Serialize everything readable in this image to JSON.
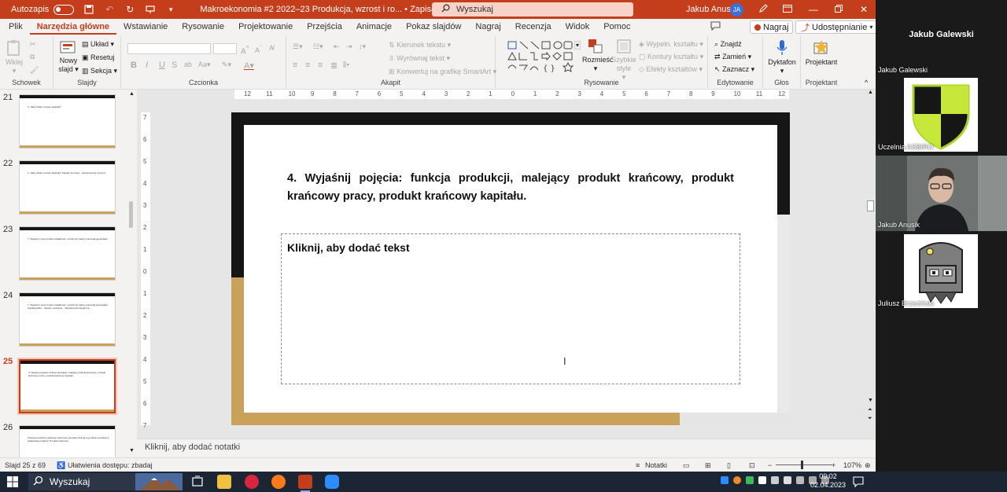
{
  "titlebar": {
    "autosave_label": "Autozapis",
    "document_title": "Makroekonomia #2 2022–23 Produkcja, wzrost i ro...  •  Zapisano w: ten komputer",
    "search_placeholder": "Wyszukaj",
    "user_name": "Jakub Anusik",
    "user_initials": "JA"
  },
  "tabs": [
    "Plik",
    "Narzędzia główne",
    "Wstawianie",
    "Rysowanie",
    "Projektowanie",
    "Przejścia",
    "Animacje",
    "Pokaz slajdów",
    "Nagraj",
    "Recenzja",
    "Widok",
    "Pomoc"
  ],
  "active_tab": "Narzędzia główne",
  "ribbon_right": {
    "record": "Nagraj",
    "share": "Udostępnianie"
  },
  "ribbon": {
    "schowek": {
      "label": "Schowek",
      "paste": "Wklej"
    },
    "slajdy": {
      "label": "Slajdy",
      "new_slide": "Nowy slajd",
      "layout": "Układ",
      "reset": "Resetuj",
      "section": "Sekcja"
    },
    "czcionka": {
      "label": "Czcionka",
      "bold": "B",
      "italic": "I",
      "underline": "U",
      "strike": "S"
    },
    "akapit": {
      "label": "Akapit",
      "text_direction": "Kierunek tekstu",
      "align_text": "Wyrównaj tekst",
      "smartart": "Konwertuj na grafikę SmartArt"
    },
    "rysowanie": {
      "label": "Rysowanie",
      "arrange": "Rozmieść",
      "quick_styles": "Szybkie style",
      "shape_fill": "Wypełn. kształtu",
      "shape_outline": "Kontury kształtu",
      "shape_effects": "Efekty kształtów"
    },
    "edytowanie": {
      "label": "Edytowanie",
      "find": "Znajdź",
      "replace": "Zamień",
      "select": "Zaznacz"
    },
    "glos": {
      "label": "Głos",
      "dictate": "Dyktafon"
    },
    "projektant": {
      "label": "Projektant",
      "designer": "Projektant"
    }
  },
  "thumbnails": [
    {
      "num": "21",
      "text": "3. Jakie działy rozwoju kapitału?"
    },
    {
      "num": "22",
      "text": "3. Jakie działy rozwoju kapitału? Kapitał rzeczowy... Reprezentuje przyrost..."
    },
    {
      "num": "23",
      "text": "7. Wyjaśnij i opisz krótko działalność, od których zależy potencjał gospodarki"
    },
    {
      "num": "24",
      "text": "7. Wyjaśnij i opisz krótko działalność, od których zależy potencjał gospodarki. Kapitał ludzki... Zasoby naturalne... Wiedza technologiczna..."
    },
    {
      "num": "25",
      "text": "4. Wyjaśnij pojęcia: funkcja produkcji, malejący produkt krańcowy, produkt krańcowy pracy, produkt krańcowy kapitału."
    },
    {
      "num": "26",
      "text": "Funkcja produkcji pokazuje zależność pomiędzy ilością czynników produkcji a wielkością produkcji. Produkt krańcowy..."
    }
  ],
  "ruler": {
    "h_ticks": [
      "12",
      "11",
      "10",
      "9",
      "8",
      "7",
      "6",
      "5",
      "4",
      "3",
      "2",
      "1",
      "0",
      "1",
      "2",
      "3",
      "4",
      "5",
      "6",
      "7",
      "8",
      "9",
      "10",
      "11",
      "12"
    ],
    "v_ticks": [
      "7",
      "6",
      "5",
      "4",
      "3",
      "2",
      "1",
      "0",
      "1",
      "2",
      "3",
      "4",
      "5",
      "6",
      "7"
    ]
  },
  "slide": {
    "title": "4. Wyjaśnij pojęcia: funkcja produkcji, malejący produkt krańcowy, produkt krańcowy pracy, produkt krańcowy kapitału.",
    "content_placeholder": "Kliknij, aby dodać tekst"
  },
  "notes_placeholder": "Kliknij, aby dodać notatki",
  "status": {
    "slide_info": "Slajd 25 z 69",
    "accessibility": "Ułatwienia dostępu: zbadaj",
    "notes": "Notatki",
    "zoom": "107%"
  },
  "taskbar": {
    "search": "Wyszukaj",
    "time": "09:02",
    "date": "02.04.2023"
  },
  "video_panel": {
    "active_speaker": "Jakub Galewski",
    "participants": [
      {
        "name": "Jakub Galewski"
      },
      {
        "name": "Uczelnia ASBIRO"
      },
      {
        "name": "Jakub Anusik"
      },
      {
        "name": "Juliusz Brzeziński"
      }
    ]
  },
  "colors": {
    "accent": "#c43e1c",
    "slide_gold": "#c9a15b",
    "slide_dark": "#161616"
  }
}
